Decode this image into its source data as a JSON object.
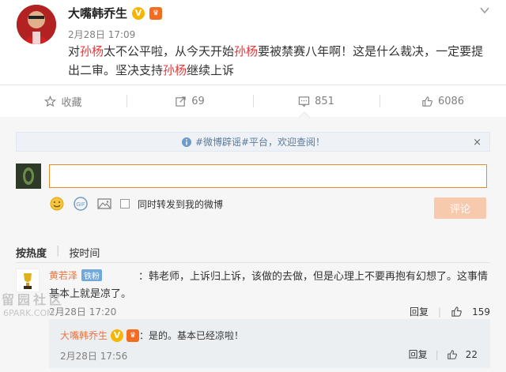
{
  "post": {
    "author": "大嘴韩乔生",
    "time": "2月28日 17:09",
    "text_parts": [
      "对",
      "孙杨",
      "太不公平啦，从今天开始",
      "孙杨",
      "要被禁赛八年啊！这是什么裁决，一定要提出二审。坚决支持",
      "孙杨",
      "继续上诉"
    ]
  },
  "actions": {
    "favorite": "收藏",
    "repost_count": "69",
    "comment_count": "851",
    "like_count": "6086"
  },
  "notice": {
    "text": "#微博辟谣#平台，欢迎查阅！",
    "close": "×"
  },
  "comment_box": {
    "input_value": "",
    "repost_option": "同时转发到我的微博",
    "submit_label": "评论"
  },
  "sort": {
    "hot": "按热度",
    "time": "按时间"
  },
  "comment": {
    "user": "黄若泽",
    "badge": "铁粉",
    "text": "韩老师，上诉归上诉，该做的去做，但是心理上不要再抱有幻想了。这事情基本上就是凉了。",
    "time": "2月28日 17:20",
    "reply_label": "回复",
    "like_count": "159"
  },
  "reply": {
    "user": "大嘴韩乔生",
    "text": "是的。基本已经凉啦！",
    "time": "2月28日 17:56",
    "reply_label": "回复",
    "like_count": "22"
  },
  "watermark": {
    "line1": "留园社区",
    "line2": "6PARK.COM"
  },
  "colors": {
    "highlight": "#e4393c",
    "username": "#eb7340",
    "accent": "#f7c9ad"
  }
}
